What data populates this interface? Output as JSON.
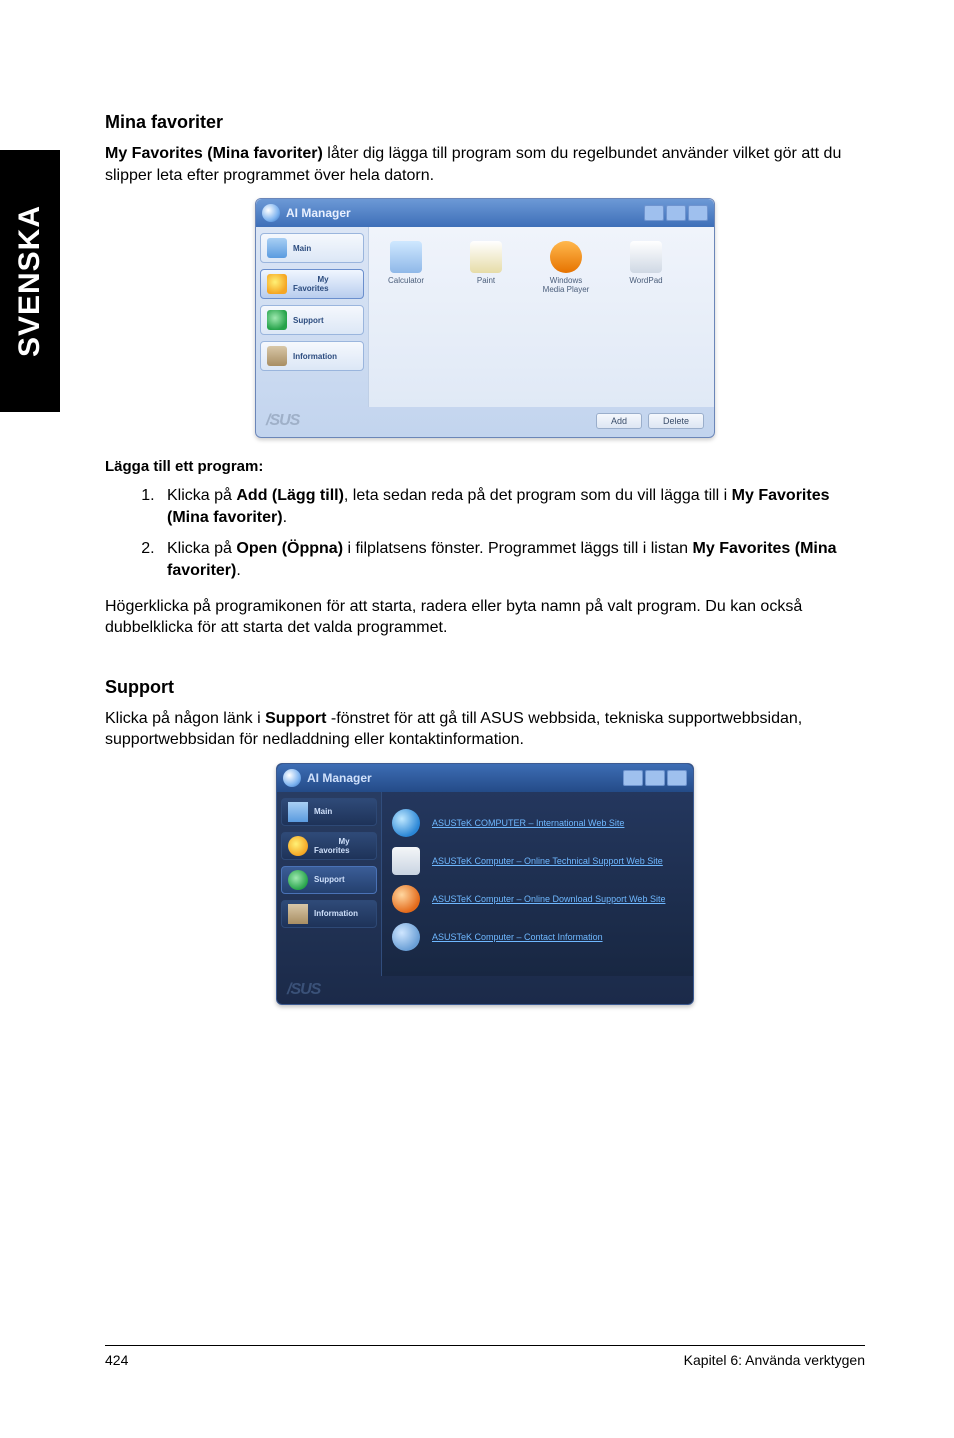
{
  "sidetab": {
    "label": "SVENSKA"
  },
  "section_favorites": {
    "heading": "Mina favoriter",
    "intro_pre": "My Favorites (Mina favoriter)",
    "intro_rest": " låter dig lägga till program som du regelbundet använder vilket gör att du slipper leta efter programmet över hela datorn."
  },
  "win1": {
    "title": "AI Manager",
    "sidebar": {
      "main": "Main",
      "fav": "My\nFavorites",
      "sup": "Support",
      "info": "Information"
    },
    "apps": {
      "calc": "Calculator",
      "paint": "Paint",
      "wmp": "Windows\nMedia Player",
      "wpad": "WordPad"
    },
    "buttons": {
      "add": "Add",
      "delete": "Delete"
    },
    "logo": "/SUS"
  },
  "steps": {
    "heading": "Lägga till ett program:",
    "s1_a": "Klicka på ",
    "s1_b": "Add (Lägg till)",
    "s1_c": ", leta sedan reda på det program som du vill lägga till i ",
    "s1_d": "My Favorites (Mina favoriter)",
    "s1_e": ".",
    "s2_a": "Klicka på ",
    "s2_b": "Open (Öppna)",
    "s2_c": " i filplatsens fönster. Programmet läggs till i listan ",
    "s2_d": "My Favorites (Mina favoriter)",
    "s2_e": "."
  },
  "paragraph_context": "Högerklicka på programikonen för att starta, radera eller byta namn på valt program. Du kan också dubbelklicka för att starta det valda programmet.",
  "section_support": {
    "heading": "Support",
    "intro_a": "Klicka på någon länk i ",
    "intro_b": "Support",
    "intro_c": " -fönstret för att gå till ASUS webbsida, tekniska supportwebbsidan, supportwebbsidan för nedladdning eller kontaktinformation."
  },
  "win2": {
    "title": "AI Manager",
    "sidebar": {
      "main": "Main",
      "fav": "My\nFavorites",
      "sup": "Support",
      "info": "Information"
    },
    "links": {
      "l1": "ASUSTeK COMPUTER – International Web Site",
      "l2": "ASUSTeK Computer – Online Technical Support Web Site",
      "l3": "ASUSTeK Computer – Online Download Support Web Site",
      "l4": "ASUSTeK Computer – Contact Information"
    },
    "logo": "/SUS"
  },
  "footer": {
    "page": "424",
    "chapter": "Kapitel 6: Använda verktygen"
  }
}
